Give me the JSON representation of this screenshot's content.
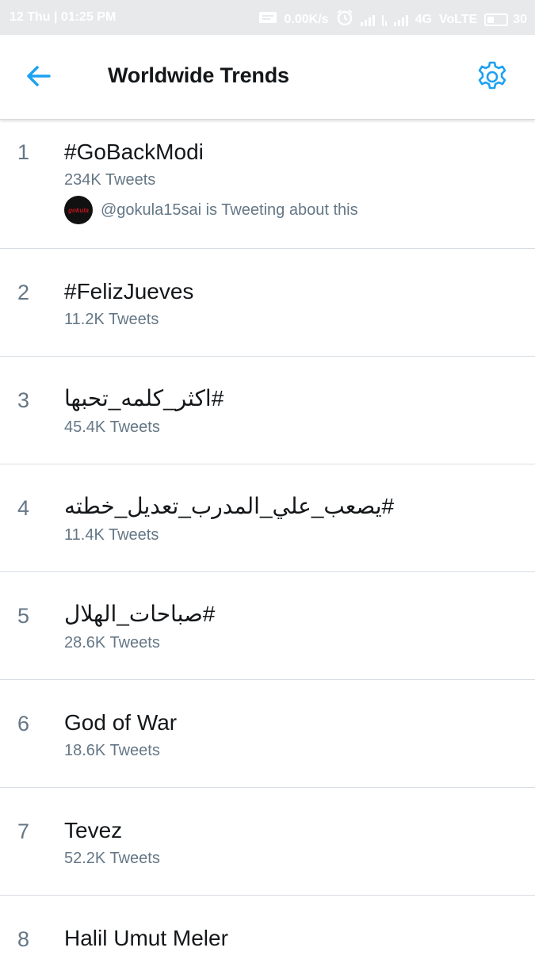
{
  "status_bar": {
    "time": "12 Thu | 01:25 PM",
    "net_speed": "0.00K/s",
    "network": "4G",
    "volte": "VoLTE",
    "battery": "30"
  },
  "header": {
    "title": "Worldwide Trends",
    "back_icon": "arrow-left-icon",
    "settings_icon": "gear-icon"
  },
  "trends": [
    {
      "rank": "1",
      "name": "#GoBackModi",
      "count": "234K Tweets",
      "context": "@gokula15sai is Tweeting about this",
      "avatar_text": "gokula"
    },
    {
      "rank": "2",
      "name": "#FelizJueves",
      "count": "11.2K Tweets"
    },
    {
      "rank": "3",
      "name": "#اكثر_كلمه_تحبها",
      "count": "45.4K Tweets"
    },
    {
      "rank": "4",
      "name": "#يصعب_علي_المدرب_تعديل_خطته",
      "count": "11.4K Tweets"
    },
    {
      "rank": "5",
      "name": "#صباحات_الهلال",
      "count": "28.6K Tweets"
    },
    {
      "rank": "6",
      "name": "God of War",
      "count": "18.6K Tweets"
    },
    {
      "rank": "7",
      "name": "Tevez",
      "count": "52.2K Tweets"
    },
    {
      "rank": "8",
      "name": "Halil Umut Meler"
    }
  ],
  "colors": {
    "accent": "#1da1f2",
    "secondary_text": "#657786",
    "primary_text": "#14171a",
    "divider": "#d7dde3"
  }
}
